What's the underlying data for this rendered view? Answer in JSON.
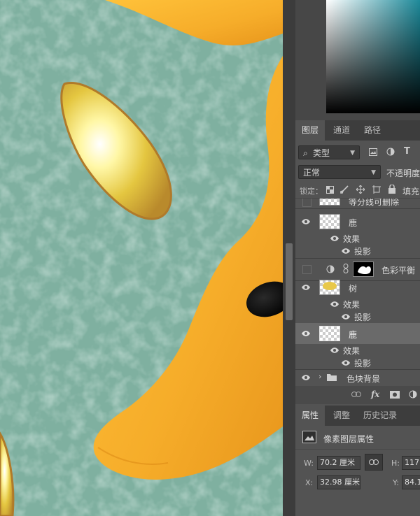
{
  "colors": {
    "canvas_bg": "#7fb0a0",
    "deer": "#f6ad2a",
    "panel_bg": "#535353",
    "panel_dark": "#3d3d3d",
    "selected_layer": "#6a6a6a"
  },
  "layers_panel": {
    "tabs": [
      "图层",
      "通道",
      "路径"
    ],
    "filter": {
      "label": "类型"
    },
    "blend_mode": "正常",
    "opacity_label": "不透明度",
    "lock_label": "锁定：",
    "fill_label": "填充",
    "layers": [
      {
        "name": "等分线可删除",
        "visible": false
      },
      {
        "name": "鹿",
        "visible": true,
        "selected": false
      },
      {
        "name": "效果",
        "visible": true
      },
      {
        "name": "投影",
        "visible": true
      },
      {
        "name": "色彩平衡",
        "visible": false
      },
      {
        "name": "树",
        "visible": true
      },
      {
        "name": "效果",
        "visible": true
      },
      {
        "name": "投影",
        "visible": true
      },
      {
        "name": "鹿",
        "visible": true,
        "selected": true
      },
      {
        "name": "效果",
        "visible": true
      },
      {
        "name": "投影",
        "visible": true
      },
      {
        "name": "色块背景",
        "visible": true,
        "group": true
      }
    ],
    "footer_icons": [
      "link-icon",
      "fx-icon",
      "mask-icon",
      "adjustment-icon"
    ],
    "fx_label": "fx"
  },
  "properties_panel": {
    "tabs": [
      "属性",
      "调整",
      "历史记录"
    ],
    "title": "像素图层属性",
    "w_label": "W:",
    "w_value": "70.2 厘米",
    "h_label": "H:",
    "h_value": "117.",
    "x_label": "X:",
    "x_value": "32.98 厘米",
    "y_label": "Y:",
    "y_value": "84.1"
  }
}
